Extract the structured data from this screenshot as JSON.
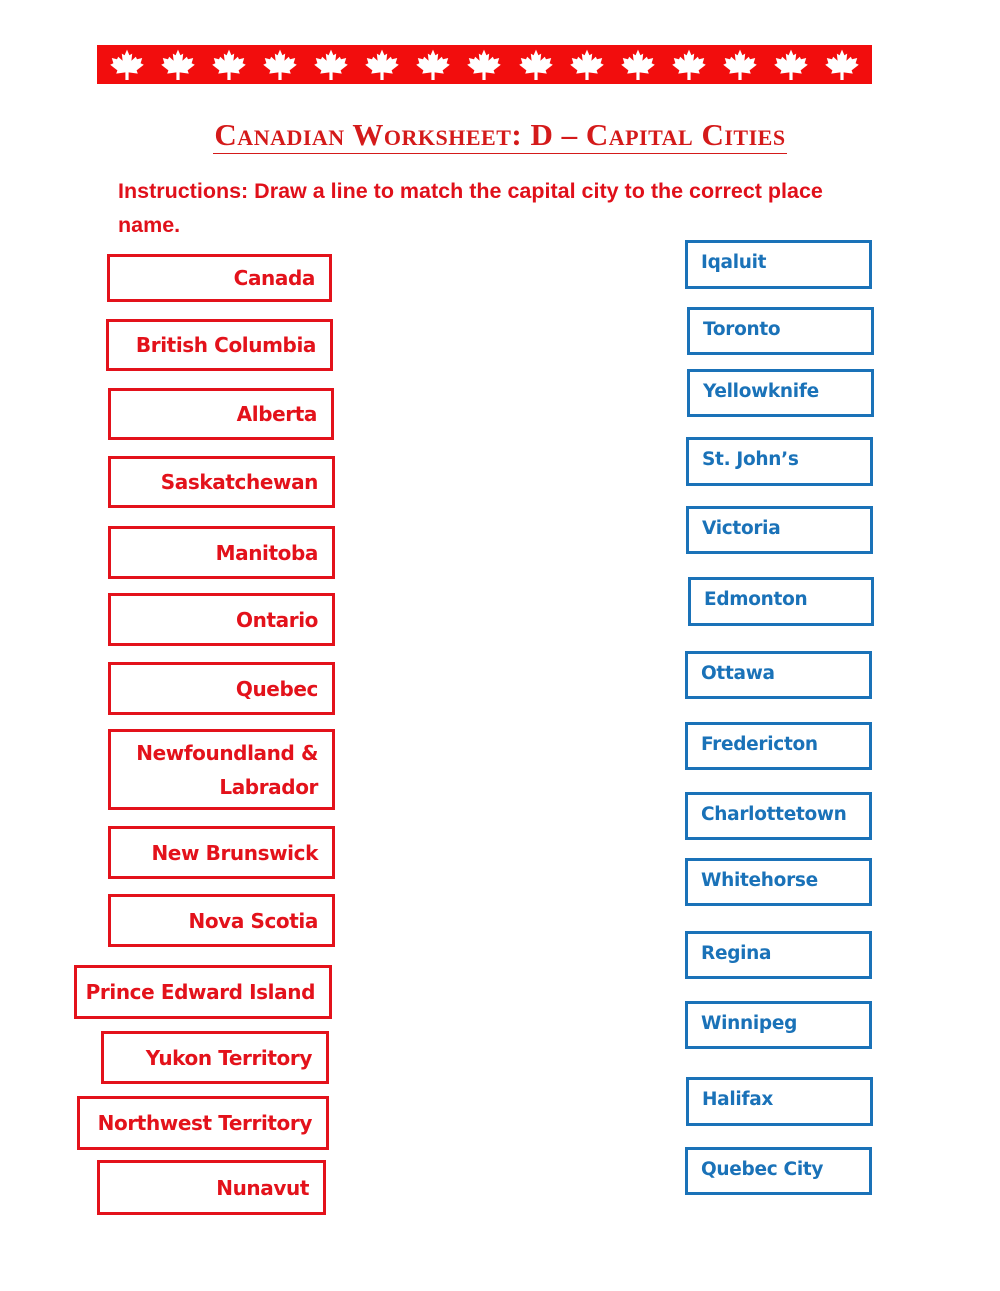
{
  "banner": {
    "icon": "maple-leaf-icon",
    "leaf_count": 15,
    "background_color": "#f20d0d",
    "leaf_color": "#ffffff"
  },
  "title": "Canadian Worksheet: D – Capital Cities",
  "instructions": "Instructions: Draw a line to match the capital city to the correct place name.",
  "colors": {
    "title": "#d41a1a",
    "places": "#e3121b",
    "cities": "#1a72b8"
  },
  "places": [
    {
      "label": "Canada"
    },
    {
      "label": "British Columbia"
    },
    {
      "label": "Alberta"
    },
    {
      "label": "Saskatchewan"
    },
    {
      "label": "Manitoba"
    },
    {
      "label": "Ontario"
    },
    {
      "label": "Quebec"
    },
    {
      "label": "Newfoundland & Labrador"
    },
    {
      "label": "New Brunswick"
    },
    {
      "label": "Nova Scotia"
    },
    {
      "label": "Prince Edward Island"
    },
    {
      "label": "Yukon Territory"
    },
    {
      "label": "Northwest Territory"
    },
    {
      "label": "Nunavut"
    }
  ],
  "cities": [
    {
      "label": "Iqaluit"
    },
    {
      "label": "Toronto"
    },
    {
      "label": "Yellowknife"
    },
    {
      "label": "St. John’s"
    },
    {
      "label": "Victoria"
    },
    {
      "label": "Edmonton"
    },
    {
      "label": "Ottawa"
    },
    {
      "label": "Fredericton"
    },
    {
      "label": "Charlottetown"
    },
    {
      "label": "Whitehorse"
    },
    {
      "label": "Regina"
    },
    {
      "label": "Winnipeg"
    },
    {
      "label": "Halifax"
    },
    {
      "label": "Quebec City"
    }
  ]
}
